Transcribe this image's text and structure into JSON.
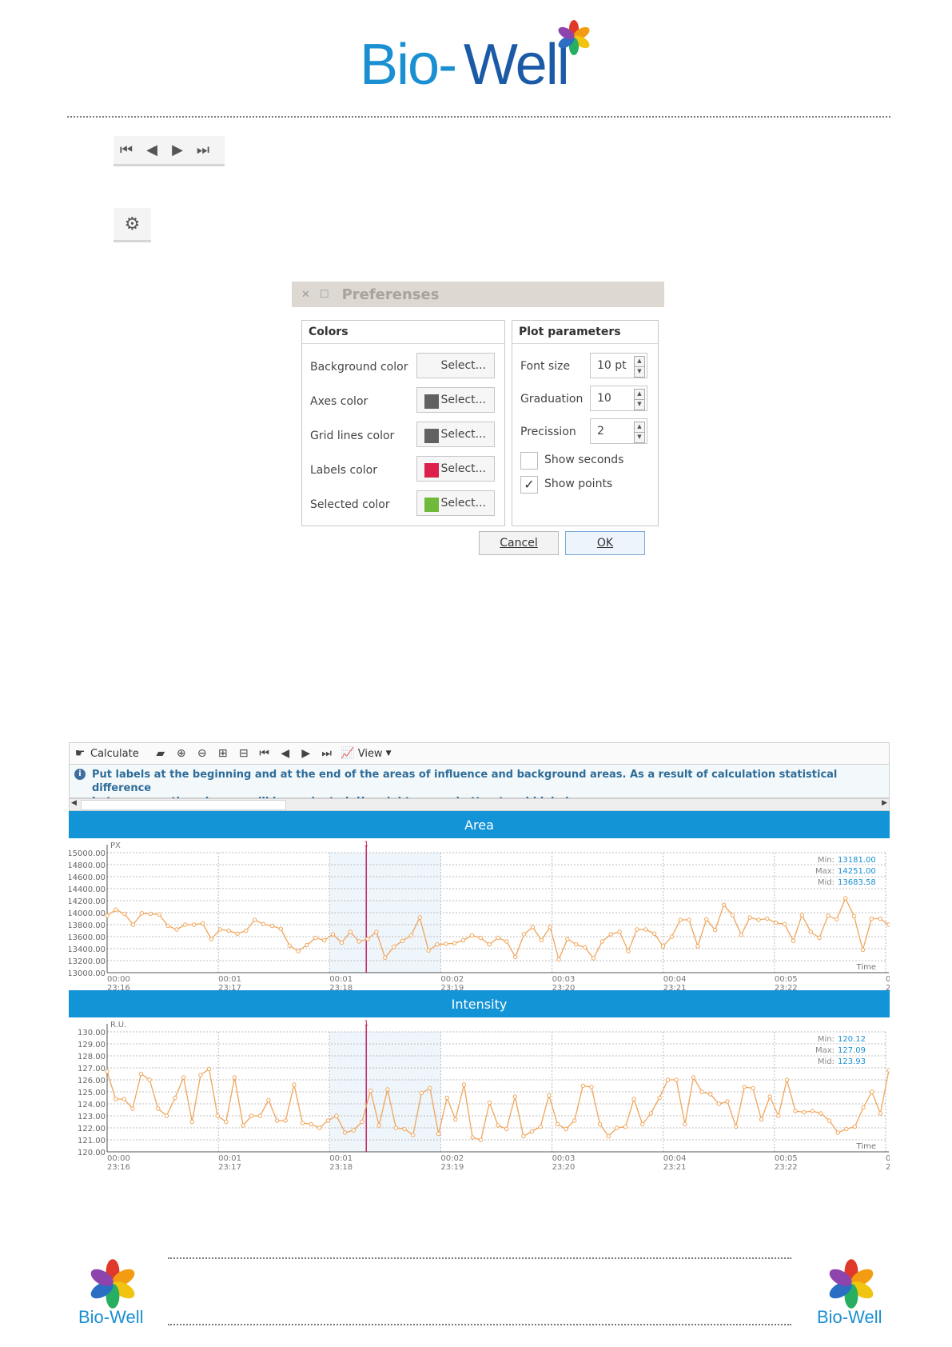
{
  "header": {
    "logo_part1": "Bio-",
    "logo_part2": "Well"
  },
  "nav_toolbar": {
    "icons": [
      "first-icon",
      "prev-icon",
      "next-icon",
      "last-icon"
    ]
  },
  "settings_toolbar": {
    "icons": [
      "gear-icon"
    ]
  },
  "dialog": {
    "title": "Preferenses",
    "colors": {
      "title": "Colors",
      "rows": [
        {
          "label": "Background color",
          "button": "Select...",
          "swatch": ""
        },
        {
          "label": "Axes color",
          "button": "Select...",
          "swatch": "#616161"
        },
        {
          "label": "Grid lines color",
          "button": "Select...",
          "swatch": "#616161"
        },
        {
          "label": "Labels color",
          "button": "Select...",
          "swatch": "#dc1f4b"
        },
        {
          "label": "Selected color",
          "button": "Select...",
          "swatch": "#6fba3a"
        }
      ]
    },
    "plot": {
      "title": "Plot parameters",
      "font_size_label": "Font size",
      "font_size_value": "10 pt",
      "graduation_label": "Graduation",
      "graduation_value": "10",
      "precision_label": "Precission",
      "precision_value": "2",
      "show_seconds_label": "Show seconds",
      "show_seconds_checked": false,
      "show_points_label": "Show points",
      "show_points_checked": true
    },
    "cancel_label": "Cancel",
    "ok_label": "OK"
  },
  "panel": {
    "toolbar": {
      "calculate_label": "Calculate",
      "view_label": "View"
    },
    "info_line1": "Put labels at the beginning and at the end of the areas of influence and background areas. As a result of calculation statistical difference",
    "info_line2": "between mentioned areas will be evaluated. Use right mouse button to add label."
  },
  "chart_data": [
    {
      "type": "line",
      "title": "Area",
      "ylabel": "PX",
      "xlabel": "Time",
      "ylim": [
        13000,
        15000
      ],
      "y_ticks": [
        "15000.00",
        "14800.00",
        "14600.00",
        "14400.00",
        "14200.00",
        "14000.00",
        "13800.00",
        "13600.00",
        "13400.00",
        "13200.00",
        "13000.00"
      ],
      "x_ticks": [
        [
          "00:00",
          "23:16"
        ],
        [
          "00:01",
          "23:17"
        ],
        [
          "00:01",
          "23:18"
        ],
        [
          "00:02",
          "23:19"
        ],
        [
          "00:03",
          "23:20"
        ],
        [
          "00:04",
          "23:21"
        ],
        [
          "00:05",
          "23:22"
        ],
        [
          "00:0",
          "23:2"
        ]
      ],
      "marker_label": "1",
      "stats": {
        "min_label": "Min:",
        "min": "13181.00",
        "max_label": "Max:",
        "max": "14251.00",
        "mid_label": "Mid:",
        "mid": "13683.58"
      },
      "values": [
        13950,
        14050,
        13980,
        13800,
        13990,
        13980,
        13970,
        13780,
        13720,
        13800,
        13800,
        13820,
        13560,
        13720,
        13700,
        13650,
        13700,
        13880,
        13810,
        13780,
        13730,
        13450,
        13360,
        13460,
        13580,
        13540,
        13640,
        13500,
        13680,
        13520,
        13560,
        13680,
        13250,
        13430,
        13530,
        13620,
        13920,
        13370,
        13470,
        13480,
        13490,
        13540,
        13620,
        13580,
        13470,
        13580,
        13520,
        13260,
        13640,
        13760,
        13540,
        13760,
        13220,
        13560,
        13470,
        13420,
        13240,
        13520,
        13640,
        13680,
        13360,
        13720,
        13720,
        13650,
        13440,
        13600,
        13880,
        13880,
        13440,
        13890,
        13710,
        14130,
        13960,
        13630,
        13920,
        13880,
        13900,
        13830,
        13810,
        13530,
        13960,
        13680,
        13580,
        13950,
        13890,
        14240,
        13940,
        13380,
        13900,
        13900,
        13800
      ]
    },
    {
      "type": "line",
      "title": "Intensity",
      "ylabel": "R.U.",
      "xlabel": "Time",
      "ylim": [
        120,
        130
      ],
      "y_ticks": [
        "130.00",
        "129.00",
        "128.00",
        "127.00",
        "126.00",
        "125.00",
        "124.00",
        "123.00",
        "122.00",
        "121.00",
        "120.00"
      ],
      "x_ticks": [
        [
          "00:00",
          "23:16"
        ],
        [
          "00:01",
          "23:17"
        ],
        [
          "00:01",
          "23:18"
        ],
        [
          "00:02",
          "23:19"
        ],
        [
          "00:03",
          "23:20"
        ],
        [
          "00:04",
          "23:21"
        ],
        [
          "00:05",
          "23:22"
        ],
        [
          "00:0",
          "23:2"
        ]
      ],
      "marker_label": "1",
      "stats": {
        "min_label": "Min:",
        "min": "120.12",
        "max_label": "Max:",
        "max": "127.09",
        "mid_label": "Mid:",
        "mid": "123.93"
      },
      "values": [
        126.7,
        124.4,
        124.4,
        123.6,
        126.5,
        126.0,
        123.6,
        123.0,
        124.5,
        126.2,
        122.5,
        126.4,
        126.9,
        123.0,
        122.5,
        126.2,
        122.2,
        123.0,
        123.0,
        124.3,
        122.6,
        122.6,
        125.6,
        122.4,
        122.3,
        122.0,
        122.6,
        123.0,
        121.6,
        121.8,
        122.5,
        125.1,
        122.2,
        125.2,
        122.0,
        121.9,
        121.4,
        124.9,
        125.3,
        121.5,
        124.5,
        122.7,
        125.6,
        121.2,
        121.0,
        124.1,
        122.2,
        121.9,
        124.6,
        121.3,
        121.7,
        122.1,
        124.7,
        122.3,
        121.9,
        122.6,
        125.5,
        125.4,
        122.3,
        121.3,
        122.0,
        122.1,
        124.4,
        122.3,
        123.2,
        124.5,
        126.0,
        126.0,
        122.3,
        126.2,
        125.0,
        124.8,
        124.0,
        124.2,
        122.1,
        125.4,
        125.3,
        122.7,
        124.6,
        123.0,
        126.0,
        123.4,
        123.3,
        123.4,
        123.2,
        122.6,
        121.6,
        121.9,
        122.1,
        123.7,
        125.0,
        123.2,
        126.8
      ]
    }
  ],
  "footer": {
    "left_label": "Bio-Well",
    "right_label": "Bio-Well"
  }
}
